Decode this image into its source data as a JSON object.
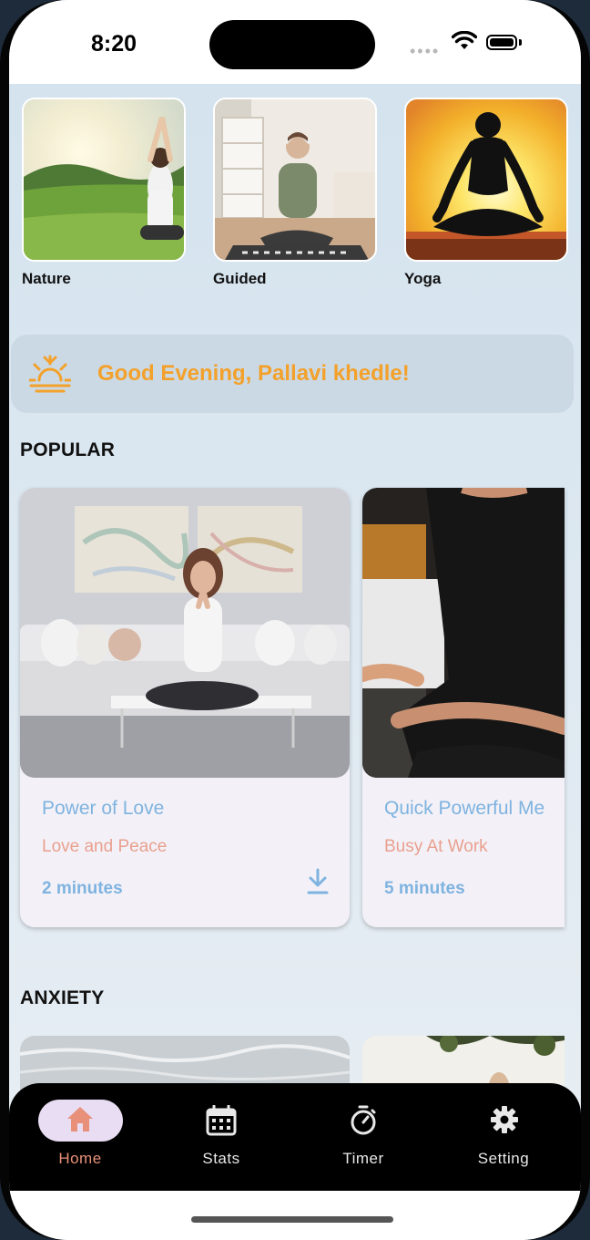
{
  "status_bar": {
    "time": "8:20"
  },
  "categories": [
    {
      "label": "Nature",
      "image": "woman-meditating-in-meadow"
    },
    {
      "label": "Guided",
      "image": "woman-meditating-with-headphones"
    },
    {
      "label": "Yoga",
      "image": "yoga-silhouette-sunset"
    }
  ],
  "greeting": {
    "text": "Good Evening, Pallavi khedle!",
    "icon": "sunset-icon"
  },
  "popular": {
    "title": "POPULAR",
    "cards": [
      {
        "title": "Power of Love",
        "subtitle": "Love and Peace",
        "duration": "2 minutes",
        "download_icon": "download-icon"
      },
      {
        "title": "Quick Powerful Me",
        "subtitle": "Busy At Work",
        "duration": "5 minutes"
      }
    ]
  },
  "anxiety": {
    "title": "ANXIETY"
  },
  "nav": {
    "items": [
      {
        "label": "Home",
        "icon": "home-icon",
        "active": true
      },
      {
        "label": "Stats",
        "icon": "calendar-icon",
        "active": false
      },
      {
        "label": "Timer",
        "icon": "timer-icon",
        "active": false
      },
      {
        "label": "Setting",
        "icon": "gear-icon",
        "active": false
      }
    ]
  },
  "colors": {
    "accent_orange": "#f3a12b",
    "title_blue": "#7fb3e0",
    "subtitle_salmon": "#e9a08f",
    "active_nav": "#e8907a"
  }
}
